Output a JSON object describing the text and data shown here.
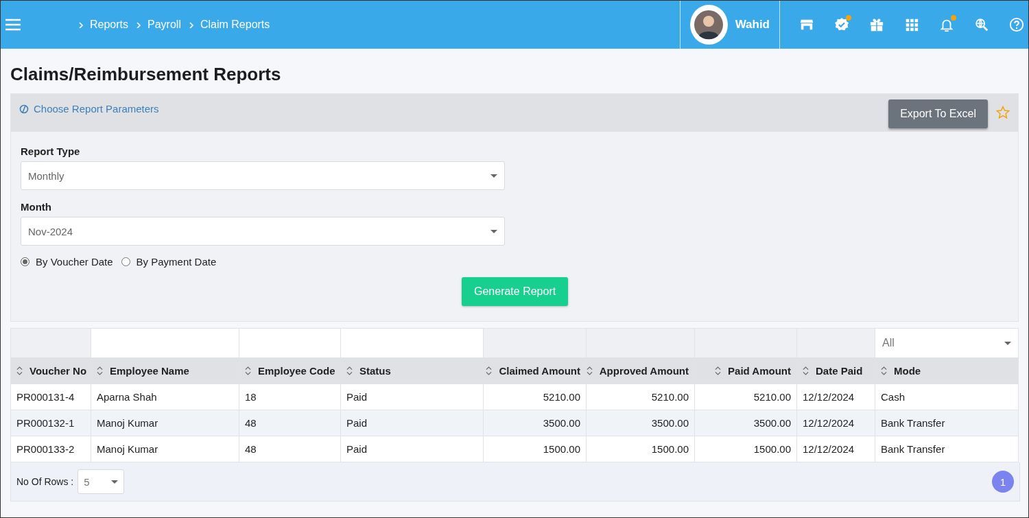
{
  "header": {
    "breadcrumb": [
      "Reports",
      "Payroll",
      "Claim Reports"
    ],
    "user": {
      "name": "Wahid"
    },
    "icons": [
      {
        "kind": "store",
        "dot": false
      },
      {
        "kind": "verified",
        "dot": true
      },
      {
        "kind": "gift",
        "dot": false
      },
      {
        "kind": "apps",
        "dot": false
      },
      {
        "kind": "bell",
        "dot": true
      },
      {
        "kind": "globe-search",
        "dot": false
      },
      {
        "kind": "help",
        "dot": false
      }
    ]
  },
  "page_title": "Claims/Reimbursement Reports",
  "params": {
    "toggle_label": "Choose Report Parameters",
    "export_button": "Export To Excel",
    "favorite": false,
    "fields": [
      {
        "label": "Report Type",
        "value": "Monthly"
      },
      {
        "label": "Month",
        "value": "Nov-2024"
      }
    ],
    "radios": [
      {
        "label": "By Voucher Date",
        "selected": true
      },
      {
        "label": "By Payment Date",
        "selected": false
      }
    ],
    "generate_button": "Generate Report"
  },
  "table": {
    "filters": [
      {
        "kind": "blank"
      },
      {
        "kind": "input"
      },
      {
        "kind": "input"
      },
      {
        "kind": "input"
      },
      {
        "kind": "blank"
      },
      {
        "kind": "blank"
      },
      {
        "kind": "blank"
      },
      {
        "kind": "blank"
      },
      {
        "kind": "select",
        "value": "All"
      }
    ],
    "columns": [
      {
        "label": "Voucher No",
        "kind": "text"
      },
      {
        "label": "Employee Name",
        "kind": "text"
      },
      {
        "label": "Employee Code",
        "kind": "text"
      },
      {
        "label": "Status",
        "kind": "text"
      },
      {
        "label": "Claimed Amount",
        "kind": "amount"
      },
      {
        "label": "Approved Amount",
        "kind": "amount"
      },
      {
        "label": "Paid Amount",
        "kind": "amount"
      },
      {
        "label": "Date Paid",
        "kind": "text"
      },
      {
        "label": "Mode",
        "kind": "text"
      }
    ],
    "rows": [
      [
        "PR000131-4",
        "Aparna Shah",
        "18",
        "Paid",
        "5210.00",
        "5210.00",
        "5210.00",
        "12/12/2024",
        "Cash"
      ],
      [
        "PR000132-1",
        "Manoj Kumar",
        "48",
        "Paid",
        "3500.00",
        "3500.00",
        "3500.00",
        "12/12/2024",
        "Bank Transfer"
      ],
      [
        "PR000133-2",
        "Manoj Kumar",
        "48",
        "Paid",
        "1500.00",
        "1500.00",
        "1500.00",
        "12/12/2024",
        "Bank Transfer"
      ]
    ]
  },
  "footer": {
    "rows_label": "No Of Rows :",
    "rows_value": "5",
    "pages": [
      {
        "label": "1",
        "selected": true
      }
    ]
  }
}
